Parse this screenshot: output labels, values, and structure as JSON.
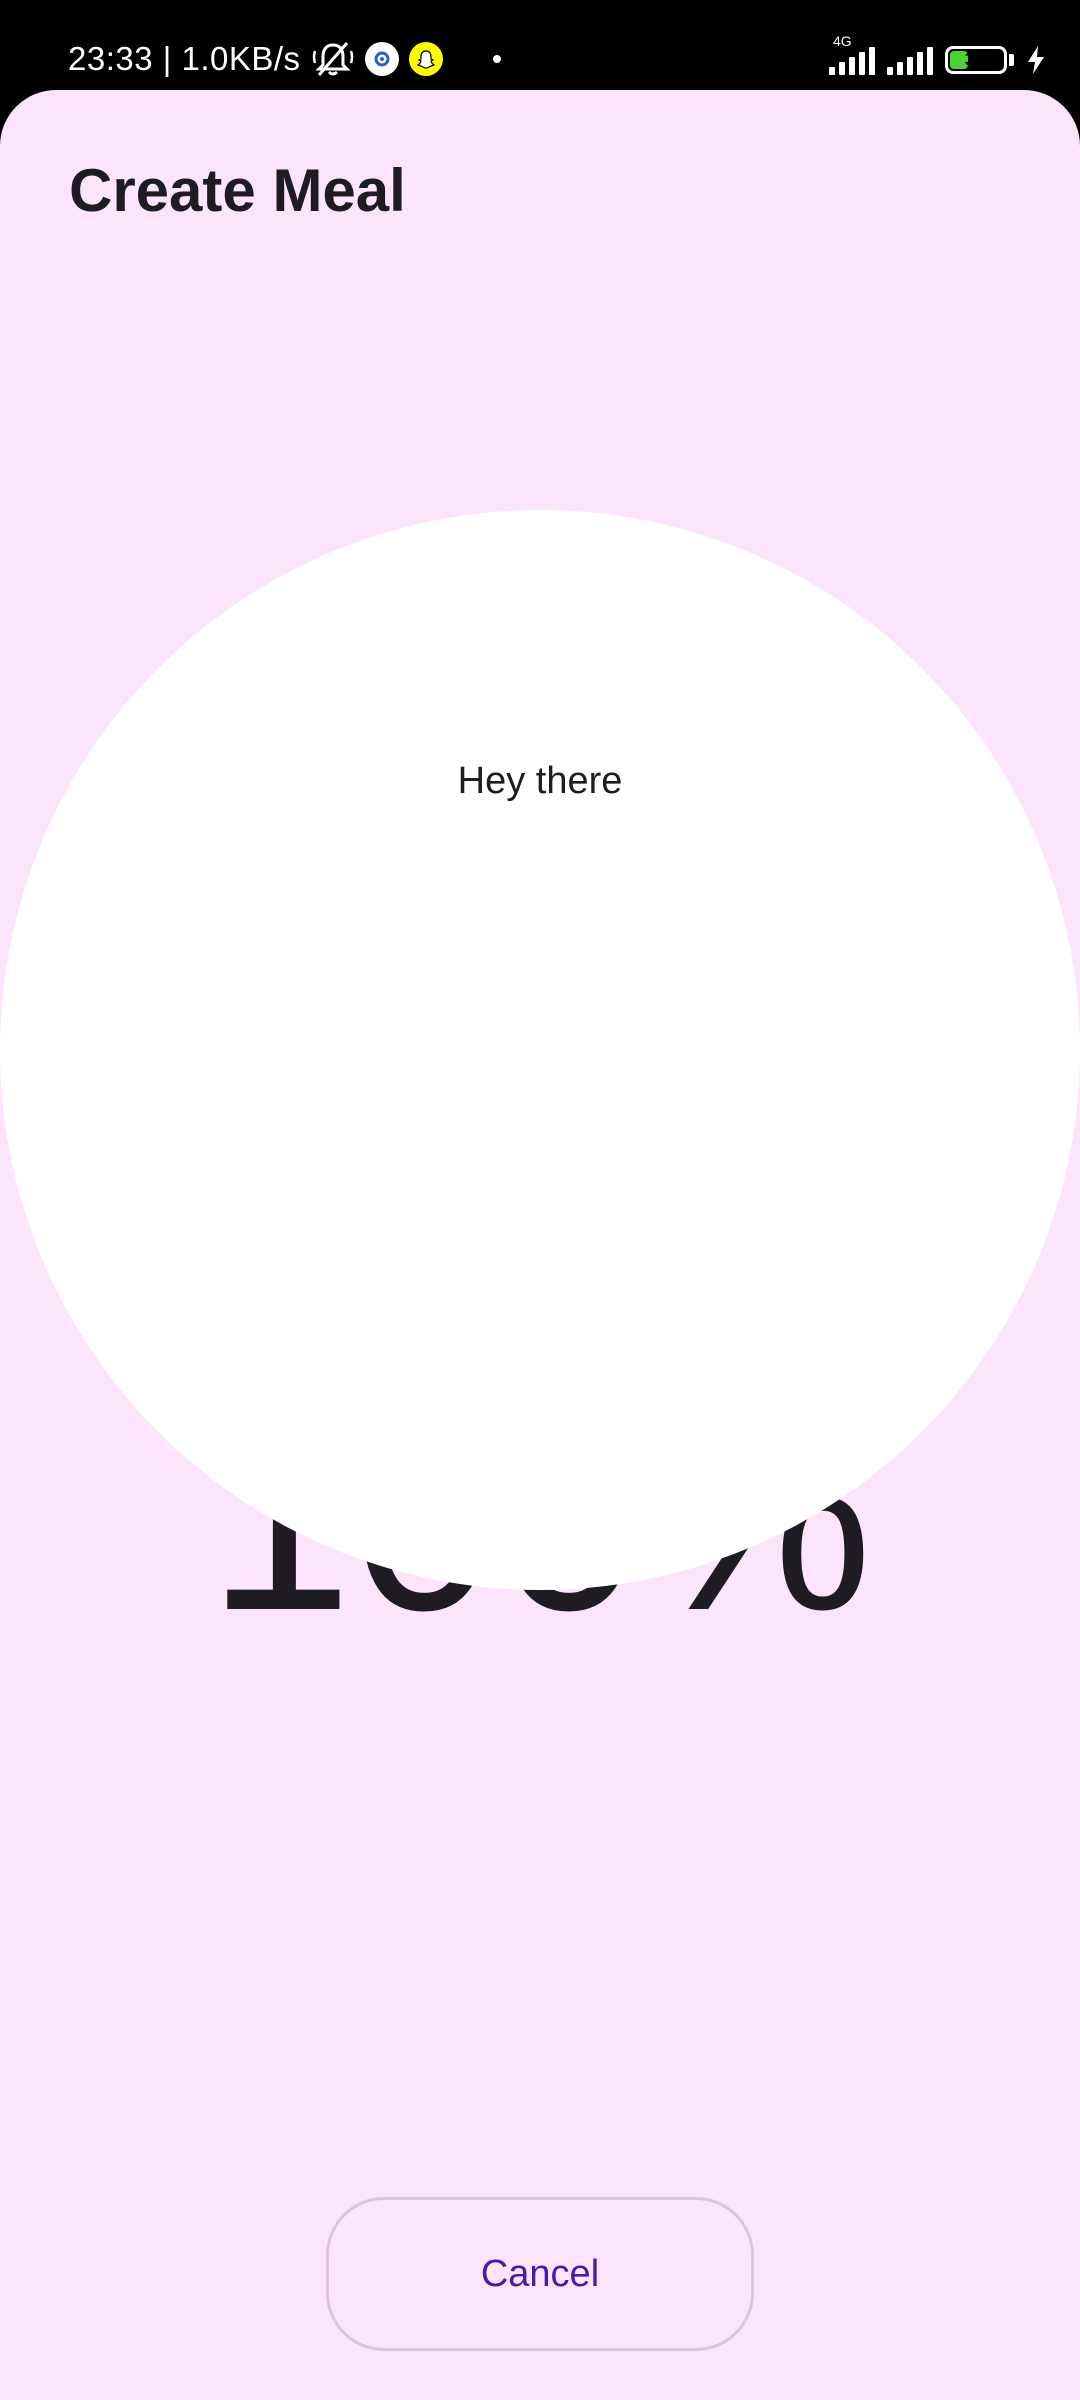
{
  "status_bar": {
    "time_and_speed": "23:33 | 1.0KB/s",
    "network_label": "4G",
    "battery_level": "32",
    "battery_percent": 32,
    "icons": [
      "mute-icon",
      "settings-app-icon",
      "snapchat-icon",
      "notification-dot-icon",
      "signal-icon",
      "signal-icon",
      "battery-icon",
      "charging-icon"
    ],
    "colors": {
      "battery_fill": "#4cd137",
      "snapchat": "#fffc00"
    }
  },
  "screen": {
    "title": "Create Meal",
    "progress_text": "100%",
    "circle_label": "Hey there",
    "cancel_label": "Cancel"
  },
  "colors": {
    "background": "#fce4fc",
    "text": "#1e1b22",
    "accent": "#4d1aa6",
    "button_border": "#dcc4dc"
  }
}
